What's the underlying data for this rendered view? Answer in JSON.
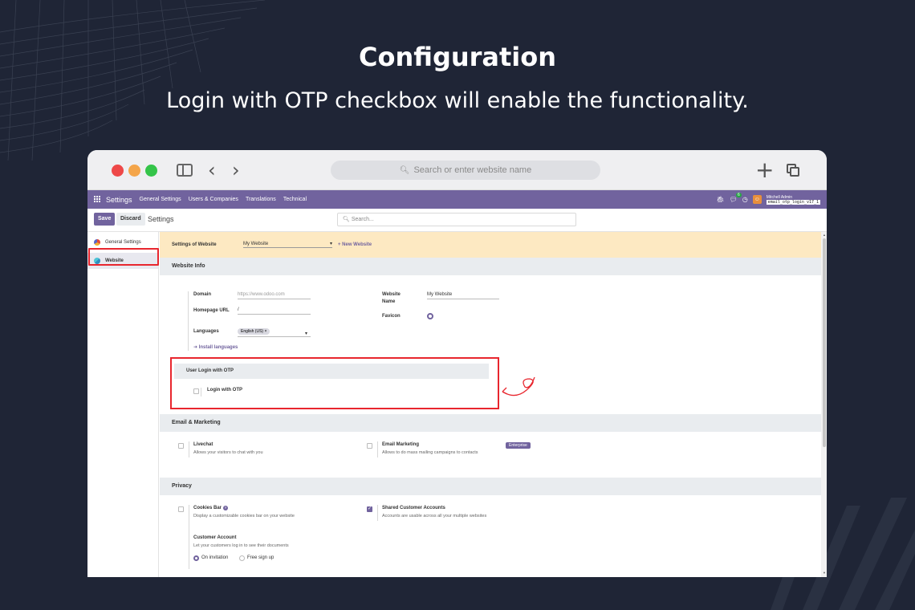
{
  "slide": {
    "heading": "Configuration",
    "subheading": "Login with OTP checkbox will enable the functionality."
  },
  "browser": {
    "url_placeholder": "Search or enter website name"
  },
  "odoo_nav": {
    "app_name": "Settings",
    "menu": [
      "General Settings",
      "Users & Companies",
      "Translations",
      "Technical"
    ],
    "chat_badge": "6",
    "user_name": "Mitchell Admin",
    "database": "email_otp_login_v17_1"
  },
  "control_panel": {
    "save_label": "Save",
    "discard_label": "Discard",
    "title": "Settings",
    "search_placeholder": "Search..."
  },
  "sidebar": {
    "items": [
      {
        "label": "General Settings",
        "icon": "general-settings-icon"
      },
      {
        "label": "Website",
        "icon": "website-icon",
        "active": true
      }
    ]
  },
  "website_selector": {
    "label": "Settings of Website",
    "selected": "My Website",
    "new_website_label": "+ New Website"
  },
  "website_info": {
    "title": "Website Info",
    "domain_label": "Domain",
    "domain_placeholder": "https://www.odoo.com",
    "homepage_label": "Homepage URL",
    "homepage_value": "/",
    "languages_label": "Languages",
    "language_tag": "English (US) ×",
    "install_languages": "➜ Install languages",
    "website_name_label": "Website Name",
    "website_name_value": "My Website",
    "favicon_label": "Favicon"
  },
  "otp_section": {
    "title": "User Login with OTP",
    "checkbox_label": "Login with OTP",
    "checked": false
  },
  "email_marketing": {
    "title": "Email & Marketing",
    "livechat_title": "Livechat",
    "livechat_desc": "Allows your visitors to chat with you",
    "email_marketing_title": "Email Marketing",
    "email_marketing_desc": "Allows to do mass mailing campaigns to contacts",
    "enterprise_badge": "Enterprise"
  },
  "privacy": {
    "title": "Privacy",
    "cookies_title": "Cookies Bar",
    "cookies_desc": "Display a customizable cookies bar on your website",
    "shared_title": "Shared Customer Accounts",
    "shared_desc": "Accounts are usable across all your multiple websites",
    "shared_checked": true,
    "customer_account_title": "Customer Account",
    "customer_account_desc": "Let your customers log in to see their documents",
    "radio_on_invitation": "On invitation",
    "radio_free_signup": "Free sign up",
    "selected_option": "On invitation"
  },
  "colors": {
    "slide_bg": "#1f2536",
    "odoo_purple": "#71639e",
    "highlight_red": "#e8262e",
    "website_banner": "#fde9c2"
  }
}
